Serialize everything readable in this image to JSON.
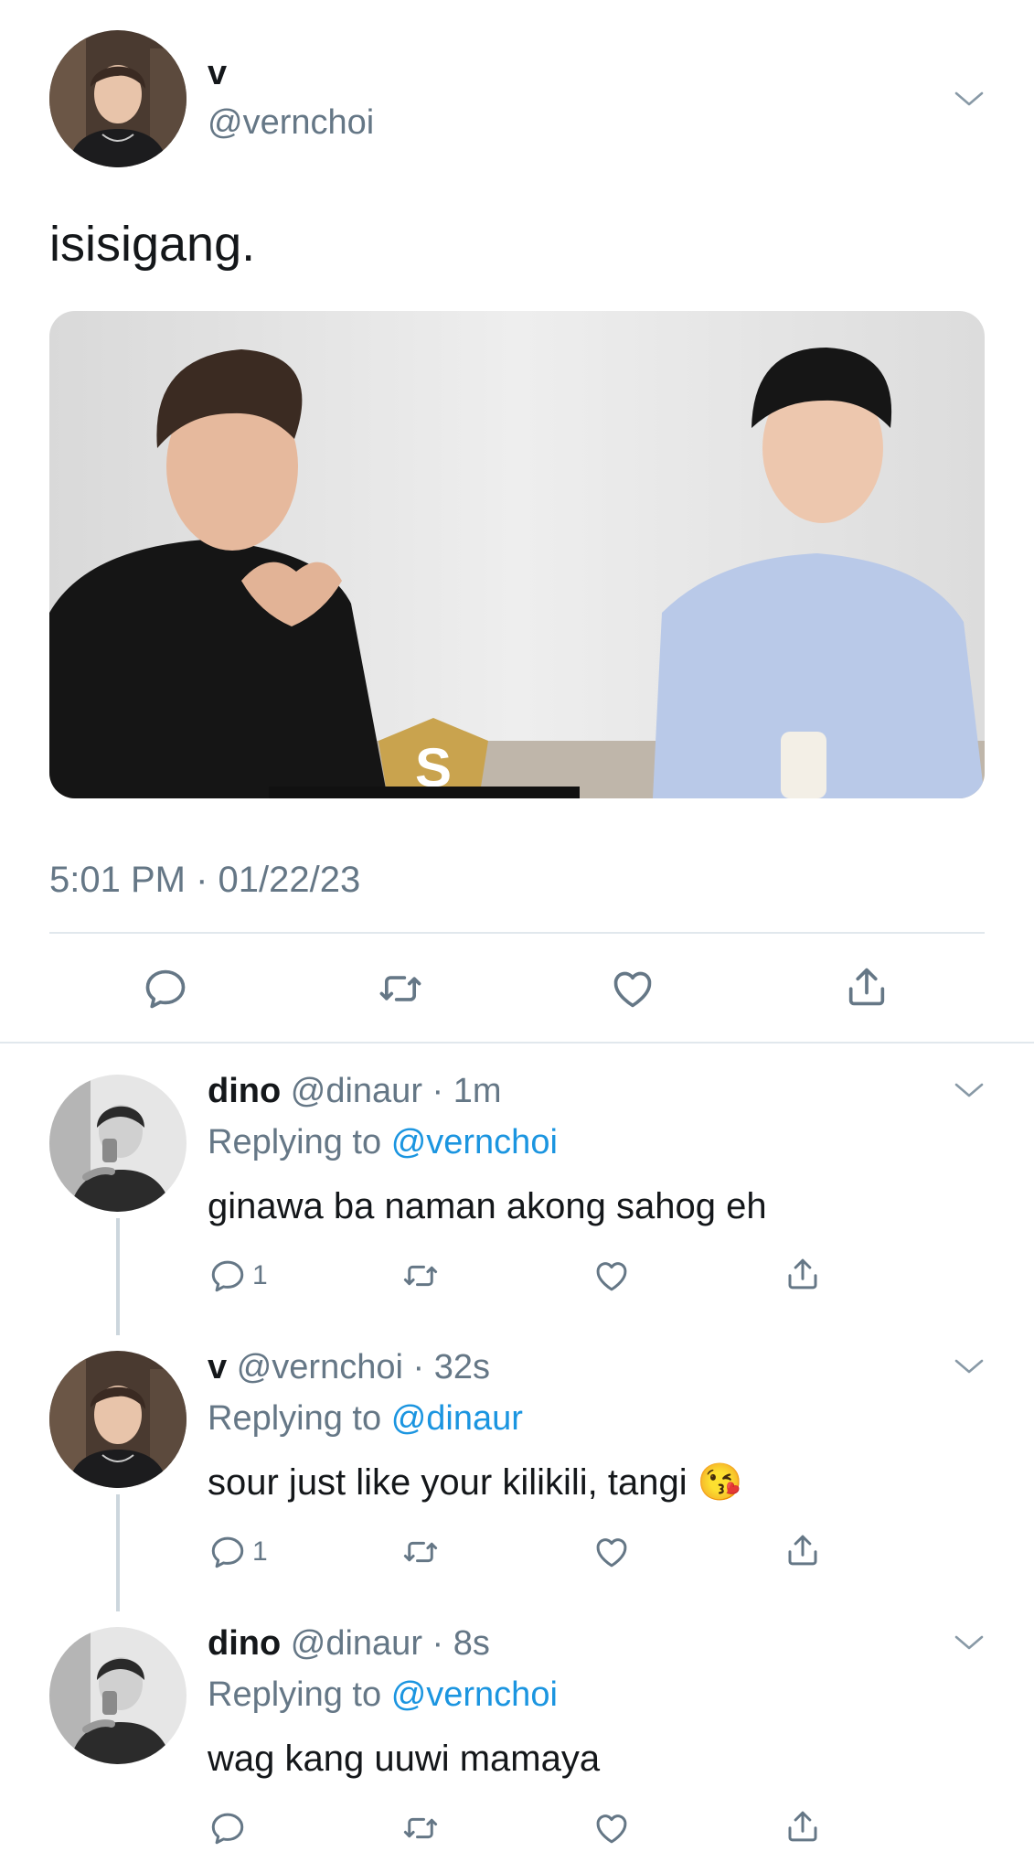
{
  "main_tweet": {
    "display_name": "v",
    "handle": "@vernchoi",
    "text": "isisigang.",
    "timestamp": "5:01 PM · 01/22/23",
    "actions": [
      "reply-icon",
      "retweet-icon",
      "like-icon",
      "share-icon"
    ]
  },
  "replies": [
    {
      "display_name": "dino",
      "handle": "@dinaur",
      "time": "1m",
      "replying_prefix": "Replying to",
      "replying_to": "@vernchoi",
      "text": "ginawa ba naman akong sahog eh",
      "reply_count": "1"
    },
    {
      "display_name": "v",
      "handle": "@vernchoi",
      "time": "32s",
      "replying_prefix": "Replying to",
      "replying_to": "@dinaur",
      "text": "sour just like your kilikili, tangi",
      "emoji": "😘",
      "reply_count": "1"
    },
    {
      "display_name": "dino",
      "handle": "@dinaur",
      "time": "8s",
      "replying_prefix": "Replying to",
      "replying_to": "@vernchoi",
      "text": "wag kang uuwi mamaya",
      "reply_count": ""
    }
  ],
  "colors": {
    "text": "#14171a",
    "muted": "#657786",
    "link": "#1b95e0",
    "divider": "#e1e8ed"
  }
}
